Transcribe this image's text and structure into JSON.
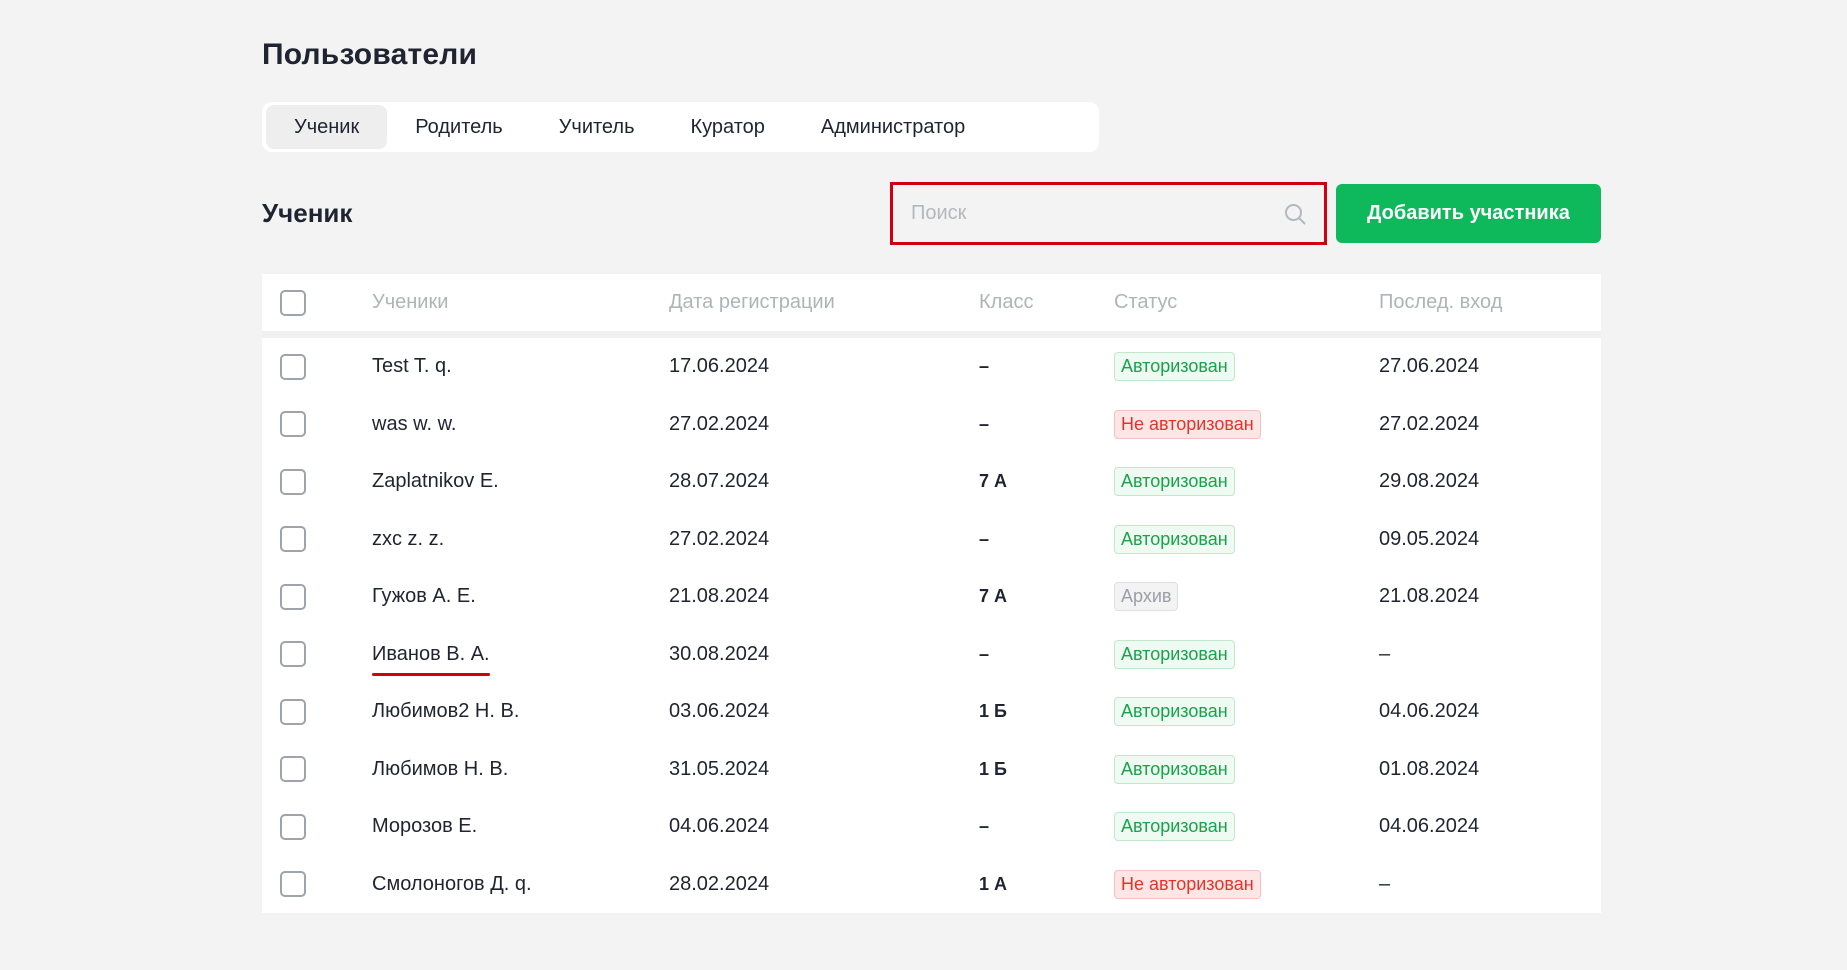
{
  "page_title": "Пользователи",
  "tabs": [
    "Ученик",
    "Родитель",
    "Учитель",
    "Куратор",
    "Администратор"
  ],
  "active_tab_index": 0,
  "section_title": "Ученик",
  "search": {
    "placeholder": "Поиск",
    "value": ""
  },
  "add_button_label": "Добавить участника",
  "colors": {
    "accent_green": "#0db95a",
    "highlight_red": "#d0000f"
  },
  "table": {
    "columns": [
      "Ученики",
      "Дата регистрации",
      "Класс",
      "Статус",
      "Послед. вход"
    ],
    "rows": [
      {
        "name": "Test T. q.",
        "reg_date": "17.06.2024",
        "class": "–",
        "status": "Авторизован",
        "status_type": "ok",
        "last_login": "27.06.2024"
      },
      {
        "name": "was w. w.",
        "reg_date": "27.02.2024",
        "class": "–",
        "status": "Не авторизован",
        "status_type": "no",
        "last_login": "27.02.2024"
      },
      {
        "name": "Zaplatnikov E.",
        "reg_date": "28.07.2024",
        "class": "7 А",
        "status": "Авторизован",
        "status_type": "ok",
        "last_login": "29.08.2024"
      },
      {
        "name": "zxc z. z.",
        "reg_date": "27.02.2024",
        "class": "–",
        "status": "Авторизован",
        "status_type": "ok",
        "last_login": "09.05.2024"
      },
      {
        "name": "Гужов А. Е.",
        "reg_date": "21.08.2024",
        "class": "7 А",
        "status": "Архив",
        "status_type": "arch",
        "last_login": "21.08.2024"
      },
      {
        "name": "Иванов В. А.",
        "reg_date": "30.08.2024",
        "class": "–",
        "status": "Авторизован",
        "status_type": "ok",
        "last_login": "–",
        "highlighted": true
      },
      {
        "name": "Любимов2 Н. В.",
        "reg_date": "03.06.2024",
        "class": "1 Б",
        "status": "Авторизован",
        "status_type": "ok",
        "last_login": "04.06.2024"
      },
      {
        "name": "Любимов Н. В.",
        "reg_date": "31.05.2024",
        "class": "1 Б",
        "status": "Авторизован",
        "status_type": "ok",
        "last_login": "01.08.2024"
      },
      {
        "name": "Морозов Е.",
        "reg_date": "04.06.2024",
        "class": "–",
        "status": "Авторизован",
        "status_type": "ok",
        "last_login": "04.06.2024"
      },
      {
        "name": "Смолоногов Д. q.",
        "reg_date": "28.02.2024",
        "class": "1 А",
        "status": "Не авторизован",
        "status_type": "no",
        "last_login": "–"
      }
    ]
  }
}
